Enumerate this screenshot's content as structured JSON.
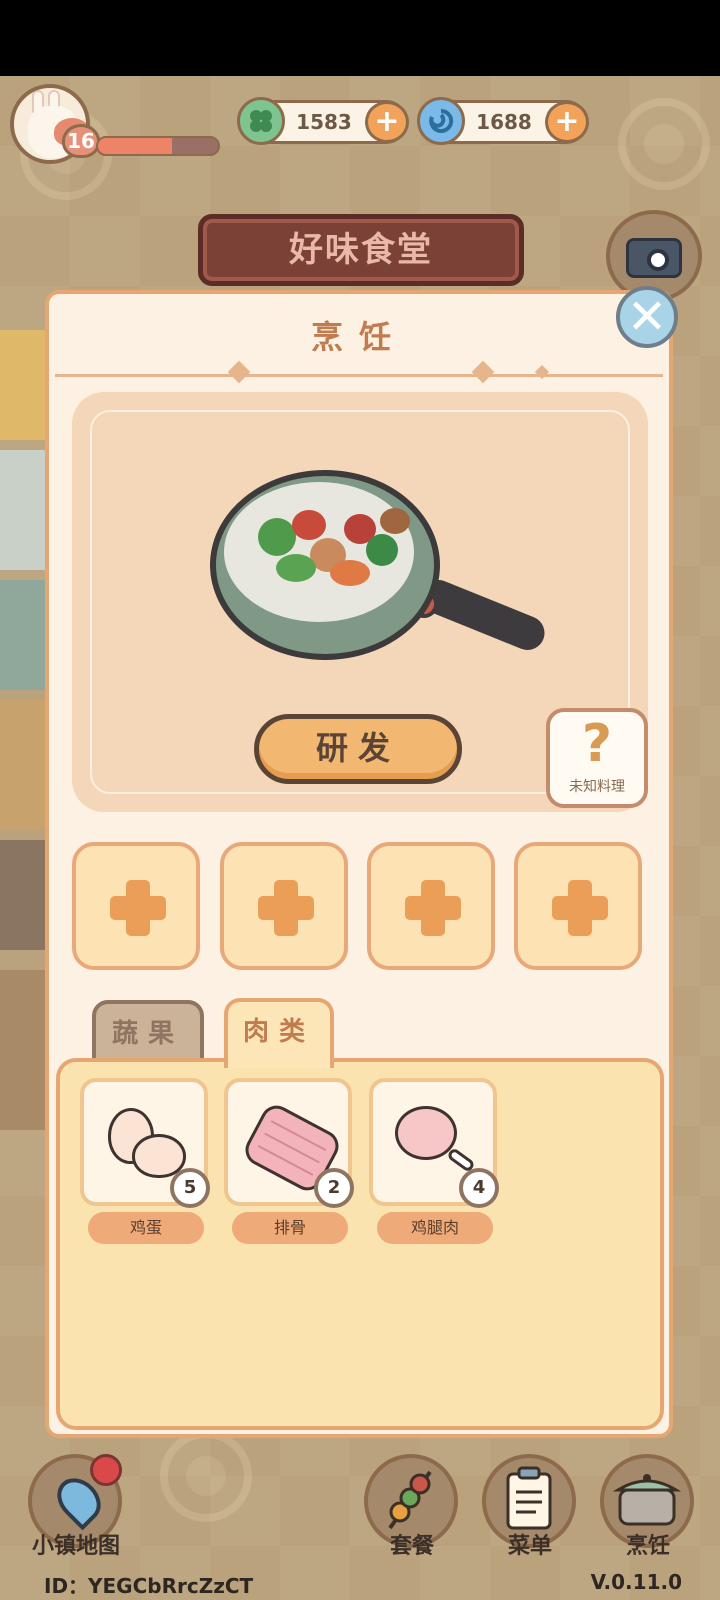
{
  "hud": {
    "level": "16",
    "xp_progress": 0.62,
    "currencies": [
      {
        "name": "clover-coin-icon",
        "value": "1583",
        "color": "#7dc48e"
      },
      {
        "name": "swirl-gem-icon",
        "value": "1688",
        "color": "#7bb9e8"
      }
    ]
  },
  "sign": {
    "title": "好味食堂"
  },
  "panel": {
    "title": "烹饪",
    "develop_label": "研发",
    "unknown_label": "未知料理",
    "unknown_symbol": "?",
    "close_symbol": "✕"
  },
  "slots": [
    {
      "name": "ingredient-slot-1"
    },
    {
      "name": "ingredient-slot-2"
    },
    {
      "name": "ingredient-slot-3"
    },
    {
      "name": "ingredient-slot-4"
    }
  ],
  "tabs": [
    {
      "label": "蔬果",
      "active": false
    },
    {
      "label": "肉类",
      "active": true
    }
  ],
  "items": [
    {
      "label": "鸡蛋",
      "count": "5",
      "icon": "eggs-icon"
    },
    {
      "label": "排骨",
      "count": "2",
      "icon": "ribs-icon"
    },
    {
      "label": "鸡腿肉",
      "count": "4",
      "icon": "drumstick-icon"
    }
  ],
  "nav": [
    {
      "label": "小镇地图",
      "icon": "map-pin-icon"
    },
    {
      "label": "套餐",
      "icon": "skewer-icon"
    },
    {
      "label": "菜单",
      "icon": "clipboard-icon"
    },
    {
      "label": "烹饪",
      "icon": "pot-icon"
    }
  ],
  "footer": {
    "id_text": "ID：YEGCbRrcZzCT",
    "version": "V.0.11.0"
  }
}
